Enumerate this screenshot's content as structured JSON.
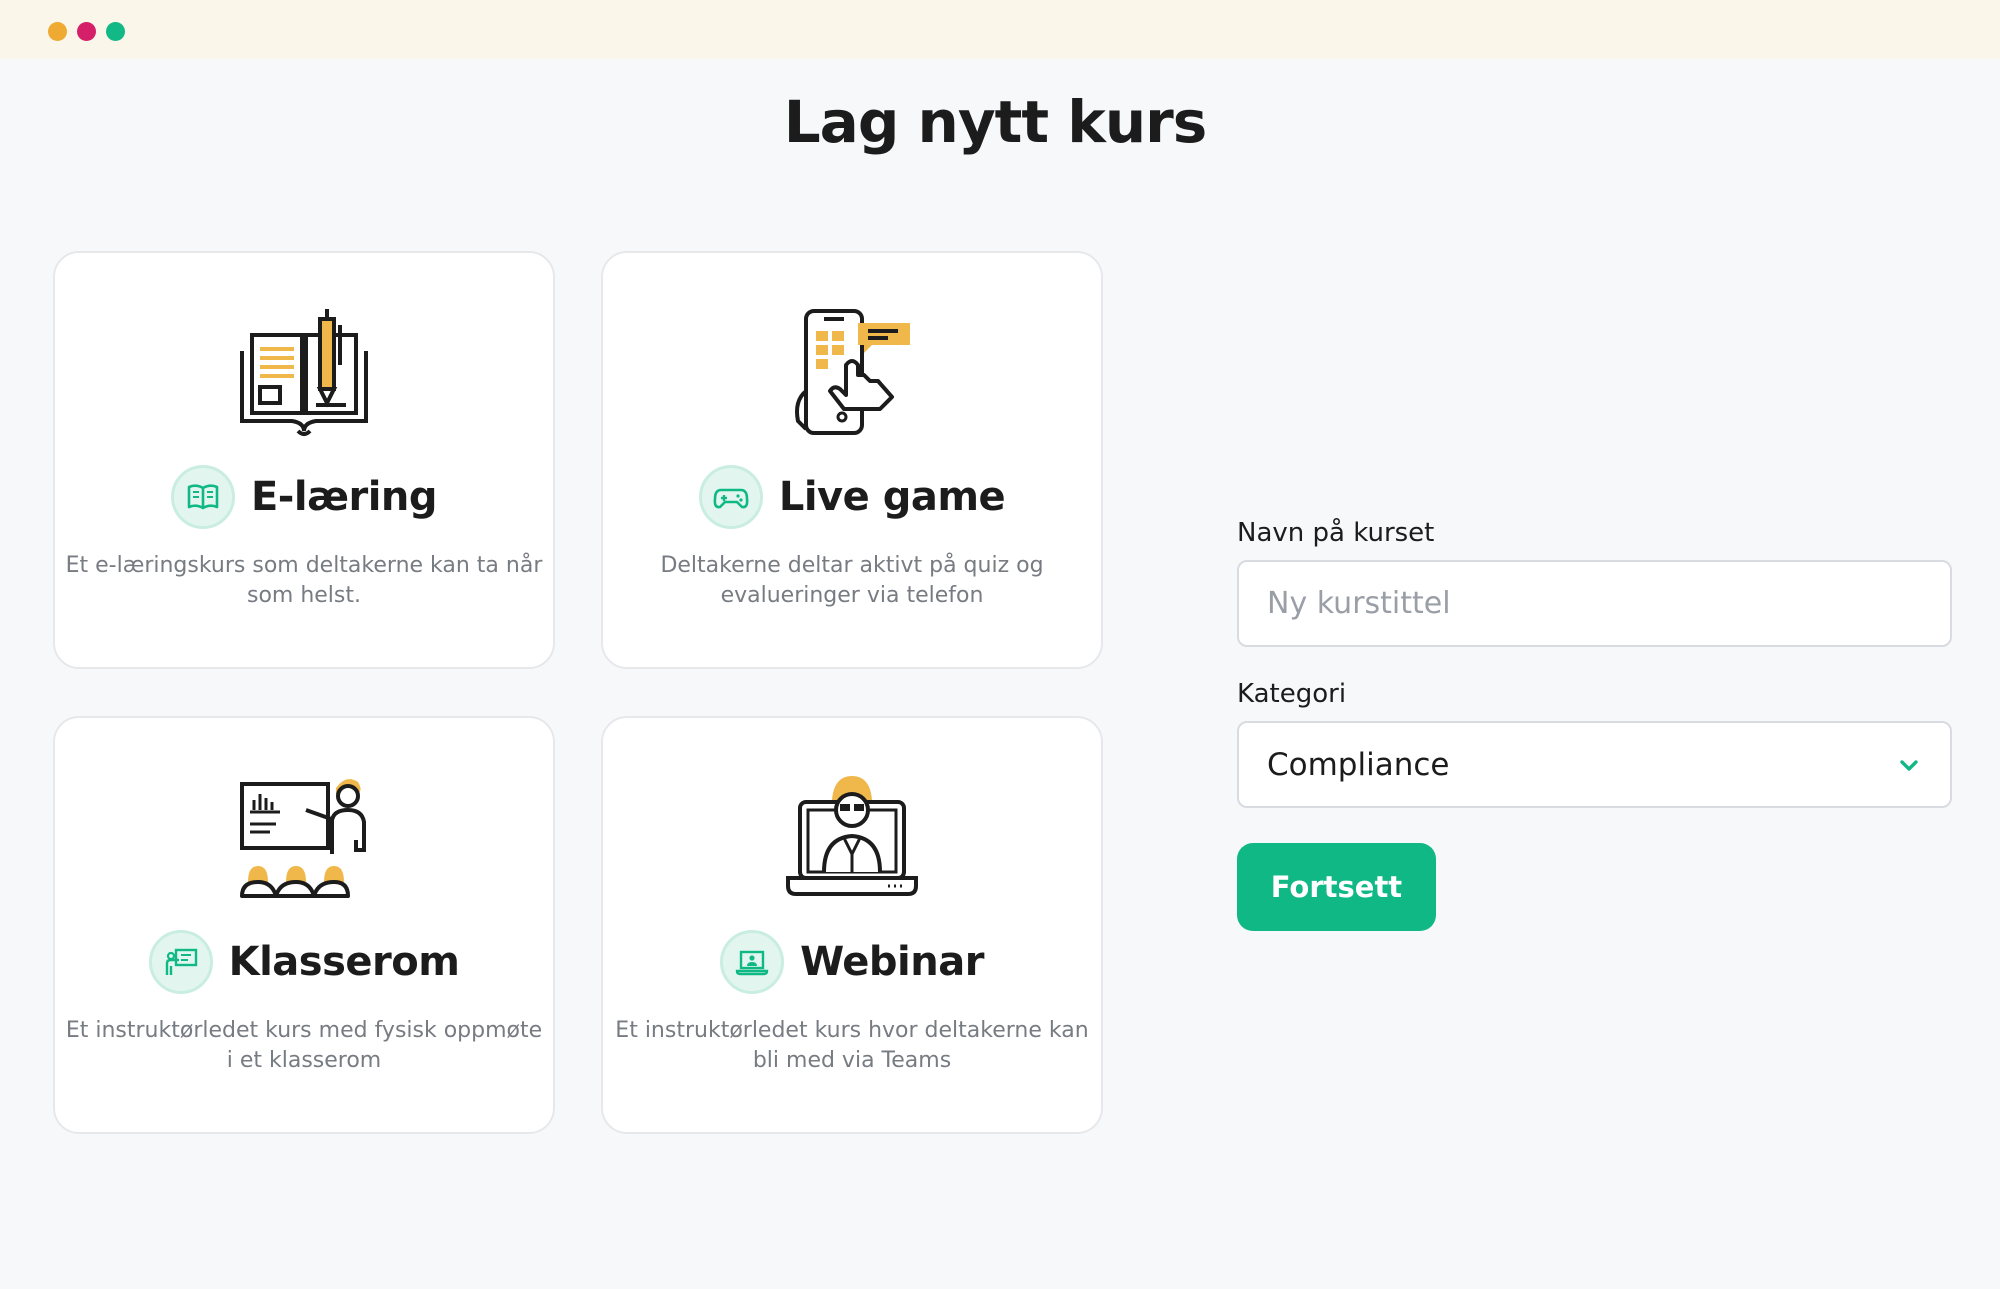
{
  "page": {
    "title": "Lag nytt kurs"
  },
  "cards": [
    {
      "title": "E-læring",
      "description": "Et e-læringskurs som deltakerne kan ta når som helst.",
      "illustration": "book-pencil-illustration",
      "icon": "open-book-icon"
    },
    {
      "title": "Live game",
      "description": "Deltakerne deltar aktivt på quiz og evalueringer via telefon",
      "illustration": "phone-tap-illustration",
      "icon": "gamepad-icon"
    },
    {
      "title": "Klasserom",
      "description": "Et instruktørledet kurs med fysisk oppmøte i et klasserom",
      "illustration": "classroom-teacher-illustration",
      "icon": "presenter-icon"
    },
    {
      "title": "Webinar",
      "description": "Et instruktørledet kurs hvor deltakerne kan bli med via Teams",
      "illustration": "laptop-webinar-illustration",
      "icon": "laptop-user-icon"
    }
  ],
  "form": {
    "name_label": "Navn på kurset",
    "name_placeholder": "Ny kurstittel",
    "name_value": "",
    "category_label": "Kategori",
    "category_value": "Compliance",
    "submit_label": "Fortsett"
  },
  "colors": {
    "accent": "#10b886",
    "illustration_yellow": "#f0b84a",
    "badge_bg": "#e2f6ef",
    "titlebar": "#faf6ea"
  },
  "window_controls": [
    "minimize-dot",
    "close-dot",
    "maximize-dot"
  ]
}
